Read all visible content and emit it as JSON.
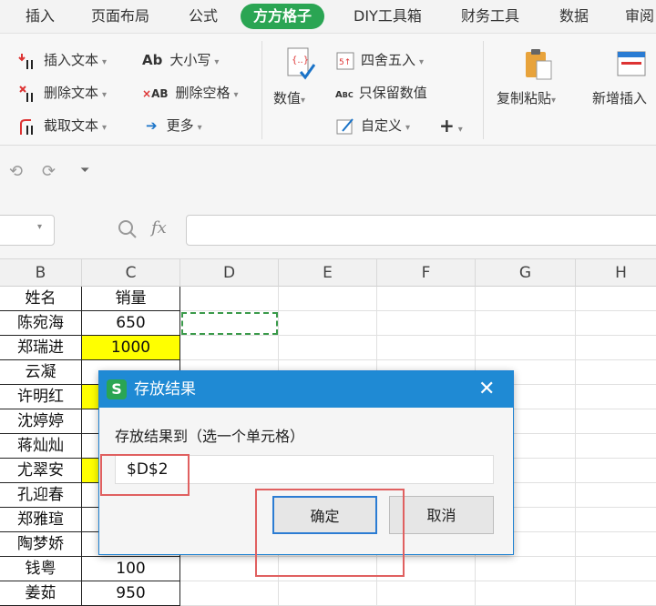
{
  "menu": {
    "items": [
      "插入",
      "页面布局",
      "公式",
      "方方格子",
      "DIY工具箱",
      "财务工具",
      "数据",
      "审阅"
    ]
  },
  "ribbon": {
    "insert_text": "插入文本",
    "delete_text": "删除文本",
    "extract_text": "截取文本",
    "case": "大小写",
    "delete_space": "删除空格",
    "more": "更多",
    "numeric": "数值",
    "round": "四舍五入",
    "keep_numeric": "只保留数值",
    "custom": "自定义",
    "copy_paste": "复制粘贴",
    "new_insert": "新增插入"
  },
  "formula_bar": {
    "fx": "fx"
  },
  "grid": {
    "columns": [
      "B",
      "C",
      "D",
      "E",
      "F",
      "G",
      "H"
    ],
    "rows": [
      {
        "b": "姓名",
        "c": "销量"
      },
      {
        "b": "陈宛海",
        "c": "650"
      },
      {
        "b": "郑瑞进",
        "c": "1000"
      },
      {
        "b": "云凝",
        "c": ""
      },
      {
        "b": "许明红",
        "c": ""
      },
      {
        "b": "沈婷婷",
        "c": ""
      },
      {
        "b": "蒋灿灿",
        "c": ""
      },
      {
        "b": "尤翠安",
        "c": ""
      },
      {
        "b": "孔迎春",
        "c": ""
      },
      {
        "b": "郑雅瑄",
        "c": ""
      },
      {
        "b": "陶梦娇",
        "c": ""
      },
      {
        "b": "钱粤",
        "c": "100"
      },
      {
        "b": "姜茹",
        "c": "950"
      }
    ]
  },
  "dialog": {
    "title": "存放结果",
    "prompt": "存放结果到（选一个单元格）",
    "value": "$D$2",
    "ok": "确定",
    "cancel": "取消"
  },
  "colors": {
    "accent": "#2aa553",
    "dialog_title": "#1f8ad4",
    "highlight": "#ffff00",
    "annotation": "#e06060"
  }
}
